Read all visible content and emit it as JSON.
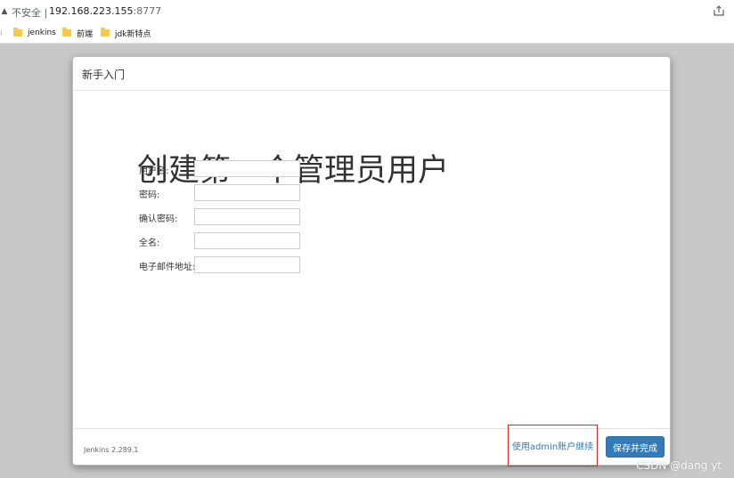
{
  "browser": {
    "insecure_label": "不安全 |",
    "url_host": "192.168.223.155",
    "url_port": ":8777"
  },
  "bookmarks": [
    "jenkins",
    "前端",
    "jdk新特点"
  ],
  "modal": {
    "header_title": "新手入门",
    "page_title": "创建第一个管理员用户",
    "fields": [
      {
        "label": "用户名:",
        "value": ""
      },
      {
        "label": "密码:",
        "value": ""
      },
      {
        "label": "确认密码:",
        "value": ""
      },
      {
        "label": "全名:",
        "value": ""
      },
      {
        "label": "电子邮件地址:",
        "value": ""
      }
    ],
    "version": "Jenkins 2.289.1",
    "continue_as_admin": "使用admin账户继续",
    "save_finish": "保存并完成"
  },
  "watermark": "CSDN @dang yt",
  "colors": {
    "primary_button": "#337ab7",
    "highlight_box": "#e0262a",
    "page_background": "#c8c8c8"
  }
}
